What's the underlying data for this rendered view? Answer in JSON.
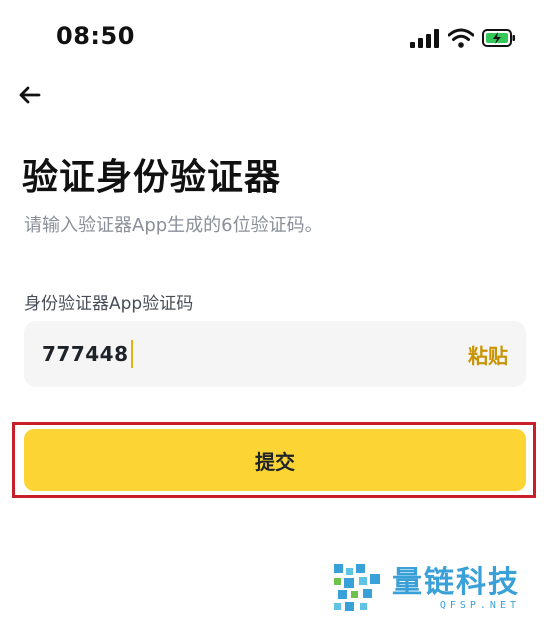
{
  "status_bar": {
    "time": "08:50"
  },
  "header": {
    "back_icon": "back-arrow-icon"
  },
  "title": "验证身份验证器",
  "subtitle": "请输入验证器App生成的6位验证码。",
  "code_field": {
    "label": "身份验证器App验证码",
    "value": "777448",
    "paste_label": "粘贴"
  },
  "submit_label": "提交",
  "watermark": {
    "name": "量链科技",
    "domain": "QFSP.NET"
  },
  "colors": {
    "accent_yellow": "#fcd535",
    "paste_text": "#c99400",
    "highlight_border": "#c8202a",
    "field_background": "#f5f5f5",
    "watermark_blue": "#3aa0d8"
  }
}
